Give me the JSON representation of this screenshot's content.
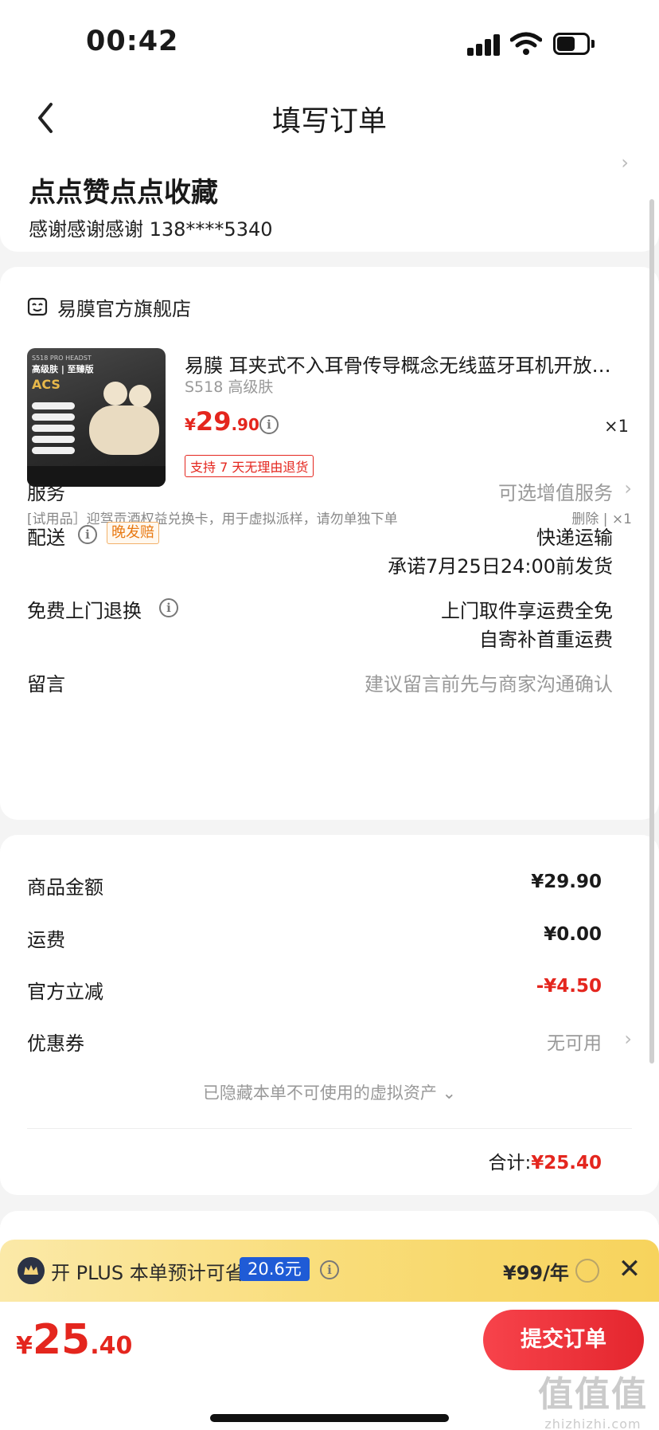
{
  "status_bar": {
    "time": "00:42"
  },
  "nav": {
    "title": "填写订单"
  },
  "address": {
    "name": "点点赞点点收藏",
    "contact": "感谢感谢感谢  138****5340",
    "chevron": "›"
  },
  "store": {
    "name": "易膜官方旗舰店",
    "icon": "store-icon"
  },
  "product": {
    "title": "易膜 耳夹式不入耳骨传导概念无线蓝牙耳机开放式运动跑步通话降噪",
    "spec": "S518 高级肤",
    "price_currency": "¥",
    "price_int": "29",
    "price_dec": ".90",
    "quantity": "×1",
    "return_policy": "支持 7 天无理由退货",
    "image_text": {
      "line1": "S518 PRO HEADST",
      "line2": "高级肤 | 至臻版",
      "line3": "ACS"
    }
  },
  "gift": {
    "text": "[试用品］迎驾贡酒权益兑换卡，用于虚拟派样，请勿单独下单",
    "actions": "删除 | ×1"
  },
  "service": {
    "label": "服务",
    "value": "可选增值服务"
  },
  "delivery": {
    "label": "配送",
    "badge": "晚发赔",
    "method": "快递运输",
    "promise": "承诺7月25日24:00前发货"
  },
  "free_return": {
    "label": "免费上门退换",
    "line1": "上门取件享运费全免",
    "line2": "自寄补首重运费"
  },
  "message": {
    "label": "留言",
    "placeholder": "建议留言前先与商家沟通确认"
  },
  "fees": {
    "goods_label": "商品金额",
    "goods_value": "¥29.90",
    "shipping_label": "运费",
    "shipping_value": "¥0.00",
    "discount_label": "官方立减",
    "discount_value": "-¥4.50",
    "coupon_label": "优惠券",
    "coupon_value": "无可用",
    "hidden_assets": "已隐藏本单不可使用的虚拟资产 ⌄",
    "total_label": "合计:",
    "total_value": "¥25.40"
  },
  "plus": {
    "text": "开 PLUS 本单预计可省",
    "save": "20.6元",
    "price": "¥99/年",
    "close": "✕"
  },
  "footer": {
    "currency": "¥",
    "int": "25",
    "dec": ".40",
    "submit": "提交订单"
  },
  "watermark": {
    "big": "值值值",
    "small": "zhizhizhi.com"
  },
  "colors": {
    "accent": "#e4261e",
    "plus_badge": "#1f5bd6",
    "plus_bg": "#f9dd7a"
  }
}
